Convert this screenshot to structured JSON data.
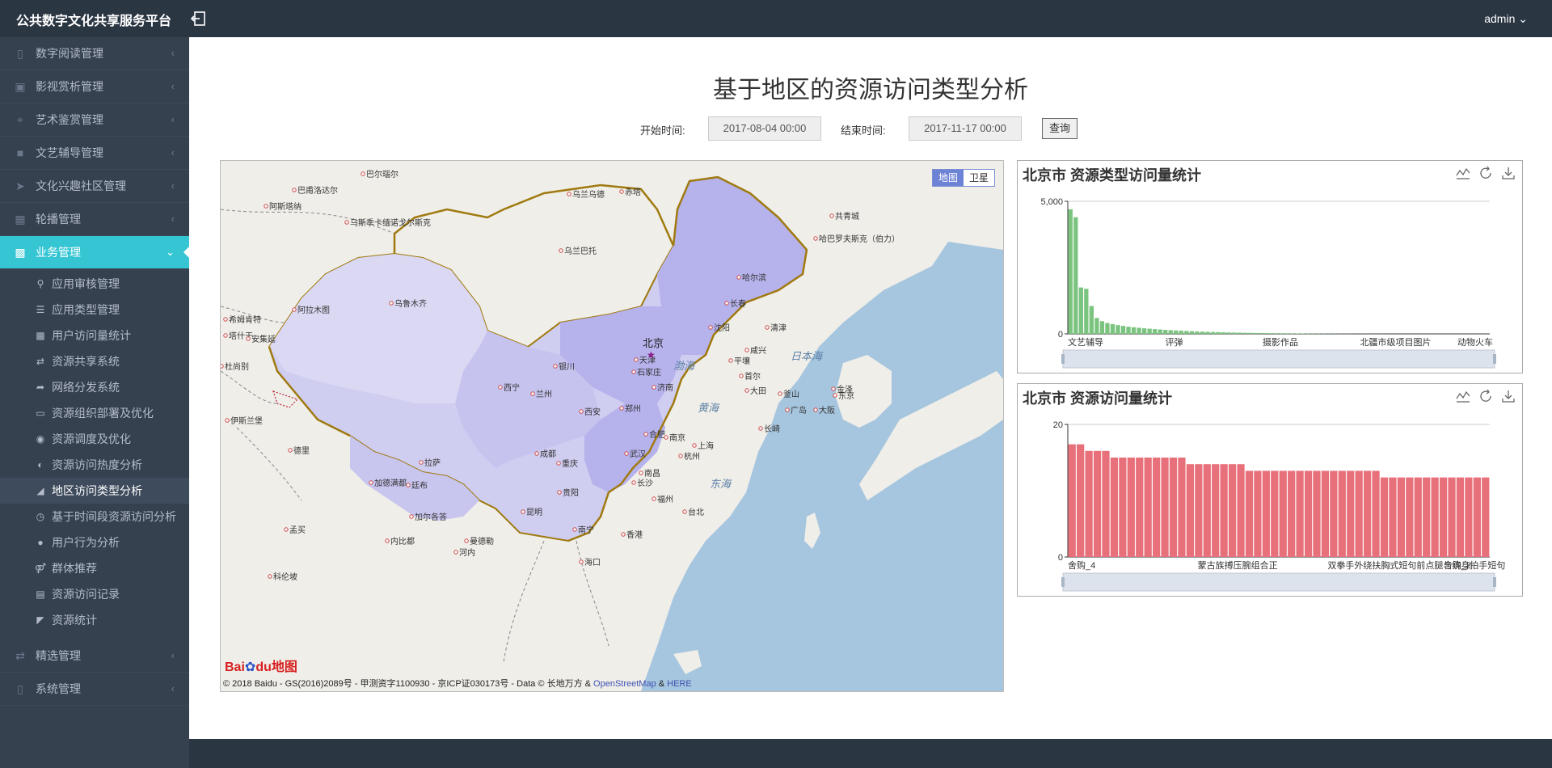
{
  "app": {
    "title": "公共数字文化共享服务平台",
    "user": "admin"
  },
  "sidebar": {
    "items": [
      {
        "label": "数字阅读管理",
        "icon": "file-icon"
      },
      {
        "label": "影视赏析管理",
        "icon": "image-icon"
      },
      {
        "label": "艺术鉴赏管理",
        "icon": "rss-icon"
      },
      {
        "label": "文艺辅导管理",
        "icon": "video-camera-icon"
      },
      {
        "label": "文化兴趣社区管理",
        "icon": "paper-plane-icon"
      },
      {
        "label": "轮播管理",
        "icon": "grid-icon"
      },
      {
        "label": "业务管理",
        "icon": "briefcase-icon"
      },
      {
        "label": "精选管理",
        "icon": "exchange-icon"
      },
      {
        "label": "系统管理",
        "icon": "tablet-icon"
      }
    ],
    "sub_items": [
      {
        "label": "应用审核管理",
        "icon": "key-icon"
      },
      {
        "label": "应用类型管理",
        "icon": "list-icon"
      },
      {
        "label": "用户访问量统计",
        "icon": "bar-chart-icon"
      },
      {
        "label": "资源共享系统",
        "icon": "exchange-icon"
      },
      {
        "label": "网络分发系统",
        "icon": "share-icon"
      },
      {
        "label": "资源组织部署及优化",
        "icon": "credit-card-icon"
      },
      {
        "label": "资源调度及优化",
        "icon": "binoculars-icon"
      },
      {
        "label": "资源访问热度分析",
        "icon": "adjust-icon"
      },
      {
        "label": "地区访问类型分析",
        "icon": "area-chart-icon"
      },
      {
        "label": "基于时间段资源访问分析",
        "icon": "clock-icon"
      },
      {
        "label": "用户行为分析",
        "icon": "user-icon"
      },
      {
        "label": "群体推荐",
        "icon": "male-icon"
      },
      {
        "label": "资源访问记录",
        "icon": "file-text-icon"
      },
      {
        "label": "资源统计",
        "icon": "line-chart-icon"
      }
    ]
  },
  "page": {
    "title": "基于地区的资源访问类型分析",
    "start_label": "开始时间:",
    "start_value": "2017-08-04 00:00",
    "end_label": "结束时间:",
    "end_value": "2017-11-17 00:00",
    "query_button": "查询"
  },
  "map": {
    "mode_map": "地图",
    "mode_satellite": "卫星",
    "copyright_prefix": "© 2018 Baidu - GS(2016)2089号 - 甲测资字1100930 - 京ICP证030173号 - Data © 长地万方 & ",
    "copyright_osm": "OpenStreetMap",
    "copyright_and": " & ",
    "copyright_here": "HERE",
    "logo_bai": "Bai",
    "logo_du": "du地图",
    "capital_label": "北京",
    "cities": [
      "巴尔瑙尔",
      "巴甫洛达尔",
      "乌斯季卡缅诺戈尔斯克",
      "阿斯塔纳",
      "乌兰乌德",
      "赤塔",
      "共青城",
      "乌兰巴托",
      "哈巴罗夫斯克（伯力）",
      "乌鲁木齐",
      "阿拉木图",
      "哈尔滨",
      "长春",
      "希姆肯特",
      "塔什干",
      "安集延",
      "杜尚别",
      "沈阳",
      "清津",
      "天津",
      "石家庄",
      "咸兴",
      "平壤",
      "首尔",
      "银川",
      "济南",
      "大田",
      "西宁",
      "兰州",
      "郑州",
      "西安",
      "伊斯兰堡",
      "合肥",
      "南京",
      "成都",
      "武汉",
      "上海",
      "杭州",
      "拉萨",
      "重庆",
      "南昌",
      "德里",
      "加德满都",
      "廷布",
      "贵阳",
      "福州",
      "长沙",
      "昆明",
      "台北",
      "加尔各答",
      "南宁",
      "香港",
      "海口",
      "曼德勒",
      "河内",
      "内比都",
      "孟买",
      "科伦坡",
      "广岛",
      "大阪",
      "东京",
      "金泽",
      "长崎",
      "釜山"
    ],
    "seas": [
      "渤海",
      "黄海",
      "东海",
      "日本海"
    ]
  },
  "charts": {
    "tool_icons": [
      "line-chart-icon",
      "refresh-icon",
      "download-icon"
    ],
    "type_chart": {
      "title": "北京市 资源类型访问量统计",
      "chart_data": {
        "type": "bar",
        "ylim": [
          0,
          5000
        ],
        "ytick_labels": [
          "0",
          "5,000"
        ],
        "xtick_labels": [
          "文艺辅导",
          "评弹",
          "摄影作品",
          "北疆市级项目图片",
          "动物火车"
        ],
        "values": [
          4700,
          4400,
          1750,
          1700,
          1050,
          600,
          480,
          410,
          370,
          330,
          300,
          270,
          250,
          230,
          210,
          195,
          180,
          165,
          150,
          140,
          130,
          120,
          110,
          100,
          92,
          85,
          78,
          72,
          66,
          60,
          55,
          50,
          46,
          42,
          38,
          35,
          32,
          29,
          26,
          24,
          22,
          20,
          18,
          16,
          14,
          12,
          10,
          9,
          8,
          7,
          6,
          5,
          5,
          4,
          4,
          3,
          3,
          2,
          2,
          2,
          1,
          1,
          1,
          1,
          1,
          1,
          1,
          1,
          1,
          1,
          1,
          1,
          1,
          1,
          1,
          1,
          1,
          1,
          1,
          1
        ],
        "color": "#7bc47f"
      }
    },
    "access_chart": {
      "title": "北京市 资源访问量统计",
      "chart_data": {
        "type": "bar",
        "ylim": [
          0,
          20
        ],
        "ytick_labels": [
          "0",
          "20"
        ],
        "xtick_labels": [
          "舍购_4",
          "蒙古族搏压腕组合正",
          "双拳手外绕扶胸式短句前点腿与绕身拍手短句",
          "舍购_2"
        ],
        "values": [
          17,
          17,
          16,
          16,
          16,
          15,
          15,
          15,
          15,
          15,
          15,
          15,
          15,
          15,
          14,
          14,
          14,
          14,
          14,
          14,
          14,
          13,
          13,
          13,
          13,
          13,
          13,
          13,
          13,
          13,
          13,
          13,
          13,
          13,
          13,
          13,
          13,
          12,
          12,
          12,
          12,
          12,
          12,
          12,
          12,
          12,
          12,
          12,
          12,
          12
        ],
        "color": "#e8707b"
      }
    }
  }
}
